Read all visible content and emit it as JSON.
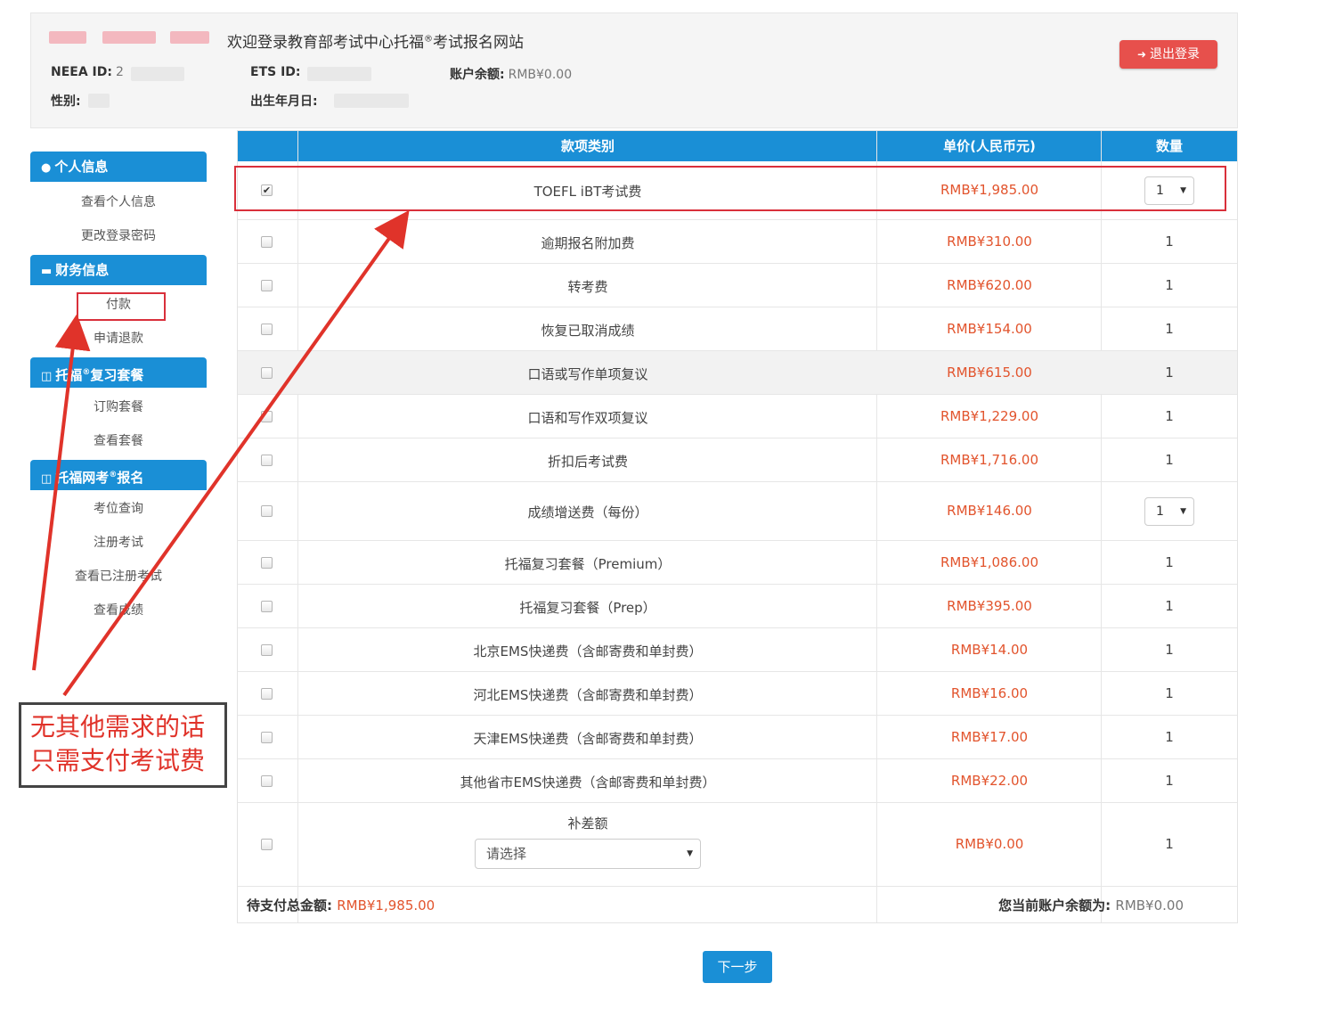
{
  "header": {
    "welcome_pre": "欢迎登录教育部考试中心托福",
    "welcome_sup": "®",
    "welcome_post": "考试报名网站",
    "neea_id_label": "NEEA ID:",
    "neea_id_value": "2",
    "ets_id_label": "ETS ID:",
    "balance_label": "账户余额:",
    "balance_value": "RMB¥0.00",
    "gender_label": "性别:",
    "birth_label": "出生年月日:",
    "logout_label": "退出登录"
  },
  "sidebar": {
    "sections": [
      {
        "title": "个人信息",
        "items": [
          "查看个人信息",
          "更改登录密码"
        ]
      },
      {
        "title": "财务信息",
        "items": [
          "付款",
          "申请退款"
        ]
      },
      {
        "title_pre": "托福",
        "title_sup": "®",
        "title_post": "复习套餐",
        "items": [
          "订购套餐",
          "查看套餐"
        ]
      },
      {
        "title_pre": "托福网考",
        "title_sup": "®",
        "title_post": "报名",
        "items": [
          "考位查询",
          "注册考试",
          "查看已注册考试",
          "查看成绩"
        ]
      }
    ]
  },
  "table": {
    "headers": [
      "款项类别",
      "单价(人民币元)",
      "数量"
    ],
    "rows": [
      {
        "item": "TOEFL iBT考试费",
        "price": "RMB¥1,985.00",
        "qty": "1",
        "checked": true
      },
      {
        "item": "逾期报名附加费",
        "price": "RMB¥310.00",
        "qty": "1",
        "checked": false
      },
      {
        "item": "转考费",
        "price": "RMB¥620.00",
        "qty": "1",
        "checked": false
      },
      {
        "item": "恢复已取消成绩",
        "price": "RMB¥154.00",
        "qty": "1",
        "checked": false
      },
      {
        "item": "口语或写作单项复议",
        "price": "RMB¥615.00",
        "qty": "1",
        "checked": false
      },
      {
        "item": "口语和写作双项复议",
        "price": "RMB¥1,229.00",
        "qty": "1",
        "checked": false
      },
      {
        "item": "折扣后考试费",
        "price": "RMB¥1,716.00",
        "qty": "1",
        "checked": false
      },
      {
        "item": "成绩增送费（每份）",
        "price": "RMB¥146.00",
        "qty": "1",
        "checked": false
      },
      {
        "item": "托福复习套餐（Premium）",
        "price": "RMB¥1,086.00",
        "qty": "1",
        "checked": false
      },
      {
        "item": "托福复习套餐（Prep）",
        "price": "RMB¥395.00",
        "qty": "1",
        "checked": false
      },
      {
        "item": "北京EMS快递费（含邮寄费和单封费）",
        "price": "RMB¥14.00",
        "qty": "1",
        "checked": false
      },
      {
        "item": "河北EMS快递费（含邮寄费和单封费）",
        "price": "RMB¥16.00",
        "qty": "1",
        "checked": false
      },
      {
        "item": "天津EMS快递费（含邮寄费和单封费）",
        "price": "RMB¥17.00",
        "qty": "1",
        "checked": false
      },
      {
        "item": "其他省市EMS快递费（含邮寄费和单封费）",
        "price": "RMB¥22.00",
        "qty": "1",
        "checked": false
      },
      {
        "item": "补差额",
        "price": "RMB¥0.00",
        "qty": "1",
        "checked": false,
        "select_placeholder": "请选择"
      }
    ],
    "total_label": "待支付总金额:",
    "total_value": "RMB¥1,985.00",
    "balance_label": "您当前账户余额为:",
    "balance_value": "RMB¥0.00"
  },
  "next_button": "下一步",
  "annotation": {
    "line1": "无其他需求的话",
    "line2": "只需支付考试费"
  },
  "colors": {
    "primary": "#1a8fd6",
    "danger": "#e7504c",
    "price": "#e2542d",
    "annotation_red": "#e0332a"
  }
}
